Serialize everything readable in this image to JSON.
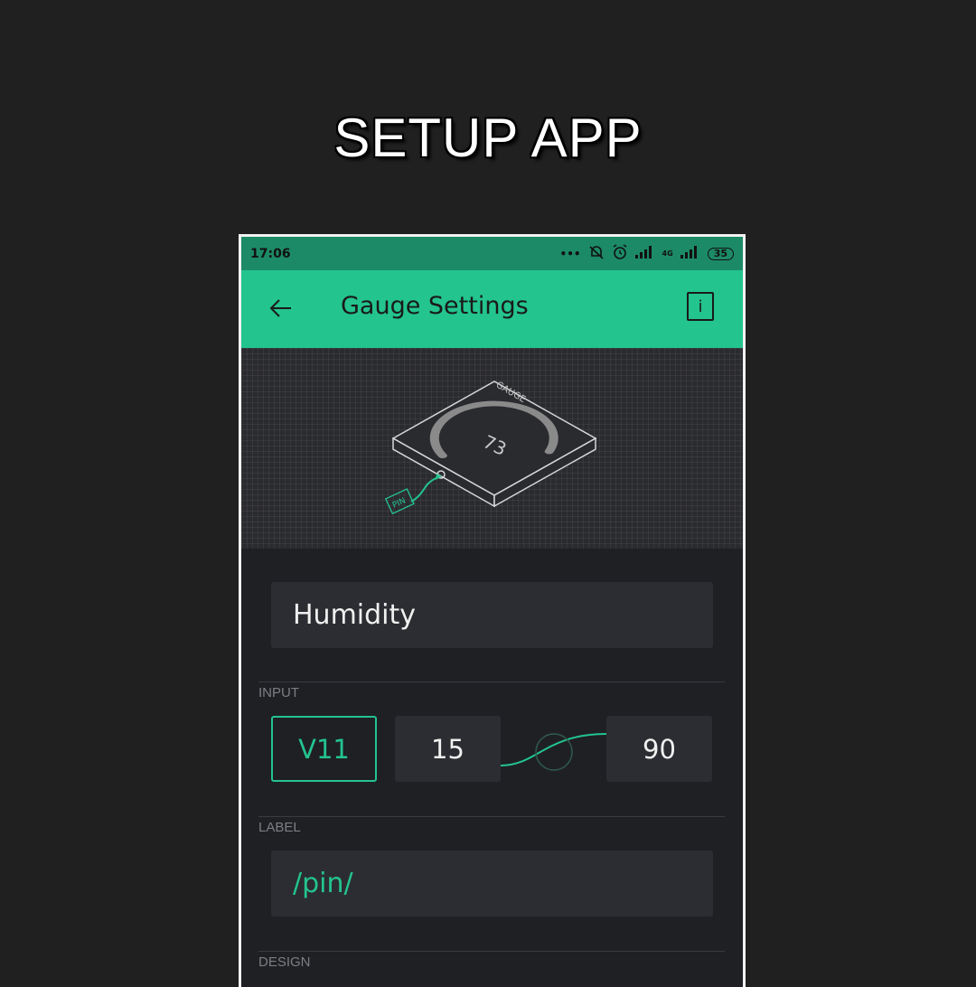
{
  "headline": "SETUP APP",
  "status_bar": {
    "time": "17:06",
    "battery": "35",
    "network": "4G"
  },
  "app_bar": {
    "title": "Gauge Settings",
    "info_label": "i"
  },
  "hero": {
    "widget_label": "GAUGE",
    "gauge_value": "73",
    "pin_label": "PIN"
  },
  "name_field": {
    "value": "Humidity"
  },
  "input": {
    "section_label": "INPUT",
    "pin": "V11",
    "min": "15",
    "max": "90"
  },
  "label_section": {
    "section_label": "LABEL",
    "value": "/pin/"
  },
  "design_section": {
    "section_label": "DESIGN"
  },
  "colors": {
    "accent": "#23c48e",
    "statusbar": "#1c8a66",
    "background": "#1f2024",
    "field": "#2c2d32"
  },
  "icons": [
    "back-arrow-icon",
    "info-icon",
    "signal-icon",
    "alarm-icon",
    "mute-icon",
    "battery-icon"
  ]
}
